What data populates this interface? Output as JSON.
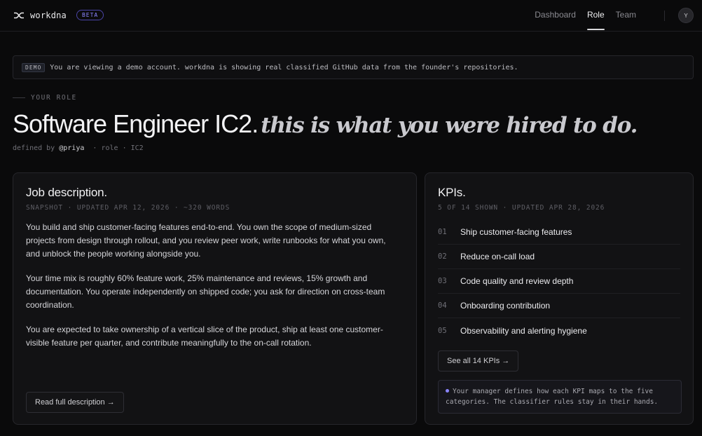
{
  "app": {
    "brand_name": "workdna",
    "beta_label": "BETA",
    "brand_icon": "shuffle-icon",
    "accent_color": "#8b85ff"
  },
  "nav": {
    "items": [
      {
        "label": "Dashboard",
        "active": false
      },
      {
        "label": "Role",
        "active": true
      },
      {
        "label": "Team",
        "active": false
      }
    ],
    "avatar_initial": "Y"
  },
  "banner": {
    "tag": "DEMO",
    "text": "You are viewing a demo account. workdna is showing real classified GitHub data from the founder's repositories."
  },
  "role": {
    "section_label": "YOUR ROLE",
    "title": "Software Engineer IC2.",
    "tagline": "this is what you were hired to do.",
    "meta_prefix": "defined by",
    "meta_author": "@priya",
    "meta_suffix": "· role · IC2"
  },
  "job_card": {
    "title": "Job description.",
    "subtitle": "SNAPSHOT · UPDATED APR 12, 2026 · ~320 WORDS",
    "paragraphs": [
      "You build and ship customer-facing features end-to-end. You own the scope of medium-sized projects from design through rollout, and you review peer work, write runbooks for what you own, and unblock the people working alongside you.",
      "Your time mix is roughly 60% feature work, 25% maintenance and reviews, 15% growth and documentation. You operate independently on shipped code; you ask for direction on cross-team coordination.",
      "You are expected to take ownership of a vertical slice of the product, ship at least one customer-visible feature per quarter, and contribute meaningfully to the on-call rotation."
    ],
    "button_label": "Read full description →"
  },
  "kpi_card": {
    "title": "KPIs.",
    "subtitle": "5 OF 14 SHOWN · UPDATED APR 28, 2026",
    "items": [
      {
        "num": "01",
        "label": "Ship customer-facing features"
      },
      {
        "num": "02",
        "label": "Reduce on-call load"
      },
      {
        "num": "03",
        "label": "Code quality and review depth"
      },
      {
        "num": "04",
        "label": "Onboarding contribution"
      },
      {
        "num": "05",
        "label": "Observability and alerting hygiene"
      }
    ],
    "button_label": "See all 14 KPIs →",
    "note": "Your manager defines how each KPI maps to the five categories. The classifier rules stay in their hands."
  }
}
